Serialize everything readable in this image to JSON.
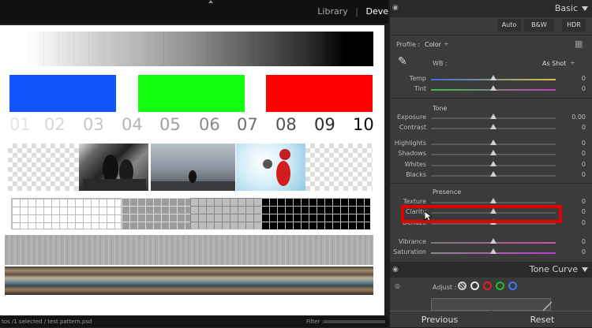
{
  "topbar": {
    "modules": [
      "Library",
      "Deve"
    ]
  },
  "test_pattern": {
    "numbers": [
      {
        "t": "01",
        "c": "#e4e4e4"
      },
      {
        "t": "02",
        "c": "#d6d6d6"
      },
      {
        "t": "03",
        "c": "#c6c6c6"
      },
      {
        "t": "04",
        "c": "#b4b4b4"
      },
      {
        "t": "05",
        "c": "#a0a0a0"
      },
      {
        "t": "06",
        "c": "#898989"
      },
      {
        "t": "07",
        "c": "#6e6e6e"
      },
      {
        "t": "08",
        "c": "#505050"
      },
      {
        "t": "09",
        "c": "#2c2c2c"
      },
      {
        "t": "10",
        "c": "#0a0a0a"
      }
    ],
    "swatches": [
      "#1155ff",
      "#11ff11",
      "#ff0000"
    ]
  },
  "filmstrip": {
    "path": "tos /1 selected / test pattern.psd",
    "filter_label": "Filter :"
  },
  "panel": {
    "title": "Basic",
    "buttons": {
      "auto": "Auto",
      "bw": "B&W",
      "hdr": "HDR"
    },
    "profile_label": "Profile :",
    "profile_value": "Color",
    "wb_label": "WB :",
    "wb_value": "As Shot",
    "tone_label": "Tone",
    "presence_label": "Presence",
    "sliders": [
      {
        "label": "Temp",
        "value": "0"
      },
      {
        "label": "Tint",
        "value": "0"
      },
      {
        "label": "Exposure",
        "value": "0.00"
      },
      {
        "label": "Contrast",
        "value": "0"
      },
      {
        "label": "Highlights",
        "value": "0"
      },
      {
        "label": "Shadows",
        "value": "0"
      },
      {
        "label": "Whites",
        "value": "0"
      },
      {
        "label": "Blacks",
        "value": "0"
      },
      {
        "label": "Texture",
        "value": "0"
      },
      {
        "label": "Clarity",
        "value": "0"
      },
      {
        "label": "Dehaze",
        "value": "0"
      },
      {
        "label": "Vibrance",
        "value": "0"
      },
      {
        "label": "Saturation",
        "value": "0"
      }
    ],
    "tone_curve_title": "Tone Curve",
    "adjust_label": "Adjust :",
    "previous_label": "Previous",
    "reset_label": "Reset"
  }
}
